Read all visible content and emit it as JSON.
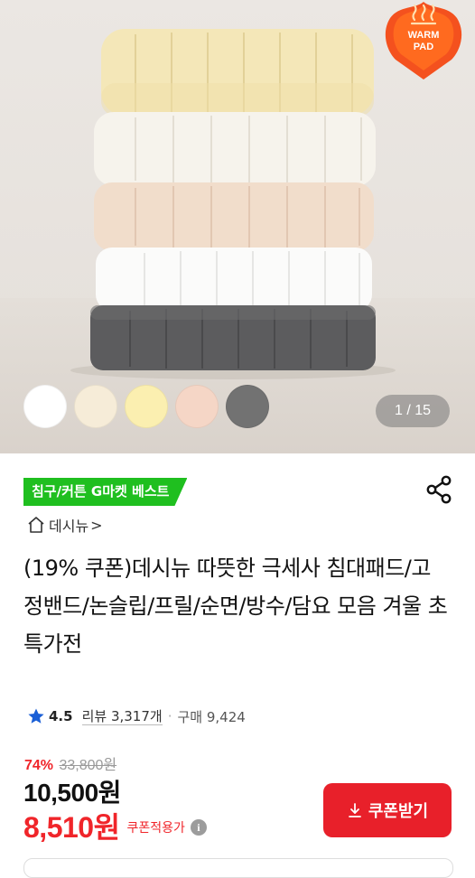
{
  "product_image": {
    "badge_line1": "WARM",
    "badge_line2": "PAD",
    "counter": "1 / 15",
    "swatch_colors": [
      "#ffffff",
      "#f6ecd8",
      "#fbefb0",
      "#f5d6c6",
      "#727272"
    ]
  },
  "category_tag": "침구/커튼 G마켓 베스트",
  "store": {
    "icon": "home-icon",
    "name": "데시뉴",
    "chevron": ">"
  },
  "title": "(19% 쿠폰)데시뉴 따뜻한 극세사 침대패드/고정밴드/논슬립/프릴/순면/방수/담요 모음 겨울 초특가전",
  "rating": {
    "score": "4.5",
    "reviews": "리뷰 3,317개",
    "separator": "·",
    "sales": "구매 9,424"
  },
  "pricing": {
    "discount_pct": "74%",
    "original_price": "33,800원",
    "price": "10,500원",
    "coupon_price": "8,510원",
    "coupon_label": "쿠폰적용가",
    "info_icon": "i"
  },
  "coupon_button": {
    "label": "쿠폰받기",
    "icon": "download-icon"
  },
  "colors": {
    "accent_red": "#e8202a",
    "tag_green": "#1fbf1f",
    "star_blue": "#1a5fd6"
  }
}
